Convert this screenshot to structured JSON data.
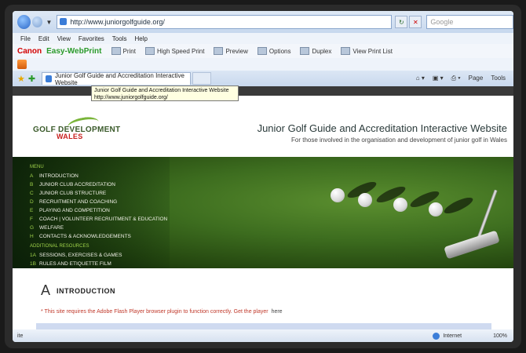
{
  "browser": {
    "address": "http://www.juniorgolfguide.org/",
    "search_placeholder": "Google",
    "menu": [
      "File",
      "Edit",
      "View",
      "Favorites",
      "Tools",
      "Help"
    ],
    "canon_brand": "Canon",
    "canon_product": "Easy-WebPrint",
    "toolbar": [
      "Print",
      "High Speed Print",
      "Preview",
      "Options",
      "Duplex",
      "View Print List"
    ],
    "tab_title": "Junior Golf Guide and Accreditation Interactive Website",
    "command_bar": [
      "Page",
      "Tools"
    ],
    "tooltip_line1": "Junior Golf Guide and Accreditation Interactive Website",
    "tooltip_line2": "http://www.juniorgolfguide.org/",
    "status_left": "Internet",
    "zoom": "100%"
  },
  "site": {
    "logo_text": "GOLF DEVELOPMENT",
    "logo_sub": "WALES",
    "title": "Junior Golf Guide and Accreditation Interactive Website",
    "subtitle": "For those involved in the organisation and development of junior golf in Wales"
  },
  "nav": {
    "heading": "MENU",
    "items": [
      {
        "key": "A",
        "label": "INTRODUCTION"
      },
      {
        "key": "B",
        "label": "JUNIOR CLUB ACCREDITATION"
      },
      {
        "key": "C",
        "label": "JUNIOR CLUB STRUCTURE"
      },
      {
        "key": "D",
        "label": "RECRUITMENT AND COACHING"
      },
      {
        "key": "E",
        "label": "PLAYING AND COMPETITION"
      },
      {
        "key": "F",
        "label": "COACH | VOLUNTEER RECRUITMENT & EDUCATION"
      },
      {
        "key": "G",
        "label": "WELFARE"
      },
      {
        "key": "H",
        "label": "CONTACTS & ACKNOWLEDGEMENTS"
      }
    ],
    "resources_heading": "ADDITIONAL RESOURCES",
    "resources": [
      {
        "key": "1A",
        "label": "SESSIONS, EXERCISES & GAMES"
      },
      {
        "key": "1B",
        "label": "RULES AND ETIQUETTE FILM"
      }
    ]
  },
  "intro": {
    "letter": "A",
    "title": "INTRODUCTION",
    "flash_note": "* This site requires the Adobe Flash Player browser plugin to function correctly. Get the player",
    "flash_link": "here"
  }
}
